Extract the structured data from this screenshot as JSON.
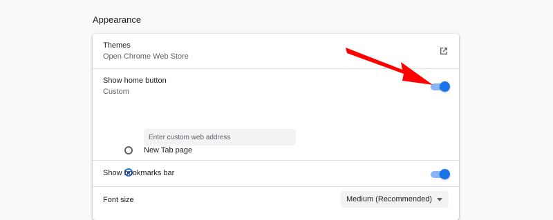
{
  "section": {
    "title": "Appearance"
  },
  "themes": {
    "label": "Themes",
    "sublabel": "Open Chrome Web Store",
    "icon": "external-link-icon"
  },
  "home_button": {
    "label": "Show home button",
    "sublabel": "Custom",
    "enabled": true,
    "options": [
      {
        "label": "New Tab page",
        "selected": false
      },
      {
        "placeholder": "Enter custom web address",
        "selected": true
      }
    ]
  },
  "bookmarks_bar": {
    "label": "Show bookmarks bar",
    "enabled": true
  },
  "font_size": {
    "label": "Font size",
    "selected": "Medium (Recommended)"
  },
  "colors": {
    "accent": "#1a73e8",
    "toggle_track": "#8ab4f8",
    "annotation_arrow": "#ff0000"
  }
}
